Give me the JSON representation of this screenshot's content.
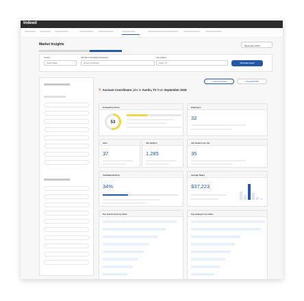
{
  "brand": {
    "logo": "Indeed"
  },
  "page": {
    "title": "Market Insights"
  },
  "date_filter": {
    "value": "September 2019"
  },
  "filters": {
    "country_label": "Country",
    "country_value": "United States",
    "job_label": "Job Title or Occupational Category",
    "job_value": "account coordinator",
    "location_label": "Job Location",
    "location_value": "Austin, TX",
    "generate_label": "Generate report"
  },
  "actions": {
    "favorites": "Add to Favorites",
    "pdf": "Download PDF"
  },
  "headline": {
    "role": "Account Coordinator",
    "jobs_in": " jobs in ",
    "location": "Austin, TX",
    "from": " from ",
    "period": "September 2019"
  },
  "cards": {
    "competition": {
      "title": "Competition Score",
      "value": "53",
      "score": 53,
      "bar_fraction": 0.37
    },
    "employers": {
      "title": "Employers",
      "value": "32"
    },
    "jobs": {
      "title": "Jobs",
      "value": "37"
    },
    "job_seekers": {
      "title": "Job Seekers",
      "value": "1,285"
    },
    "per_job": {
      "title": "Job Seekers per Job",
      "value": "35"
    },
    "devices": {
      "title": "Candidate Devices",
      "value": "34%",
      "fraction": 0.34
    },
    "salary": {
      "title": "Average Salary",
      "value": "$37,223"
    },
    "search_terms": {
      "title": "Top search terms by clicks"
    },
    "top_employers": {
      "title": "Top employers by clicks"
    }
  },
  "colors": {
    "accent": "#2557a7",
    "gauge": "#f5d34a",
    "topbar": "#2d2d2d",
    "alert": "#c0392b"
  }
}
